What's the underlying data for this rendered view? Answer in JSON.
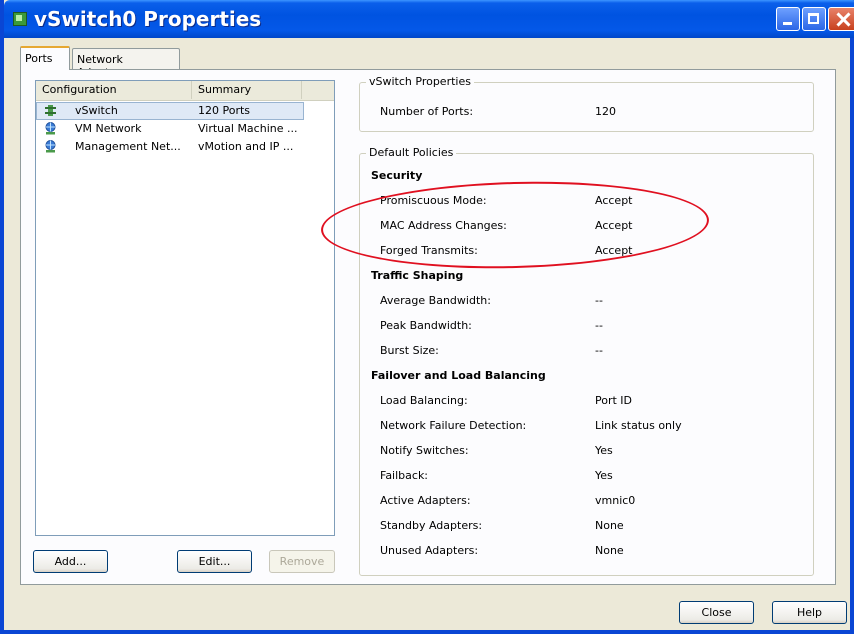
{
  "window": {
    "title": "vSwitch0 Properties"
  },
  "tabs": [
    {
      "label": "Ports"
    },
    {
      "label": "Network Adapters"
    }
  ],
  "list": {
    "headers": [
      "Configuration",
      "Summary"
    ],
    "rows": [
      {
        "icon": "vswitch-icon",
        "label": "vSwitch",
        "summary": "120 Ports"
      },
      {
        "icon": "network-globe-icon",
        "label": "VM Network",
        "summary": "Virtual Machine ..."
      },
      {
        "icon": "network-globe-icon",
        "label": "Management Net...",
        "summary": "vMotion and IP ..."
      }
    ]
  },
  "list_buttons": {
    "add": "Add...",
    "edit": "Edit...",
    "remove": "Remove"
  },
  "vswitch_properties": {
    "title": "vSwitch Properties",
    "number_of_ports_label": "Number of Ports:",
    "number_of_ports_value": "120"
  },
  "default_policies": {
    "title": "Default Policies",
    "security": {
      "heading": "Security",
      "items": [
        {
          "label": "Promiscuous Mode:",
          "value": "Accept"
        },
        {
          "label": "MAC Address Changes:",
          "value": "Accept"
        },
        {
          "label": "Forged Transmits:",
          "value": "Accept"
        }
      ]
    },
    "traffic_shaping": {
      "heading": "Traffic Shaping",
      "items": [
        {
          "label": "Average Bandwidth:",
          "value": "--"
        },
        {
          "label": "Peak Bandwidth:",
          "value": "--"
        },
        {
          "label": "Burst Size:",
          "value": "--"
        }
      ]
    },
    "failover": {
      "heading": "Failover and Load Balancing",
      "items": [
        {
          "label": "Load Balancing:",
          "value": "Port ID"
        },
        {
          "label": "Network Failure Detection:",
          "value": "Link status only"
        },
        {
          "label": "Notify Switches:",
          "value": "Yes"
        },
        {
          "label": "Failback:",
          "value": "Yes"
        },
        {
          "label": "Active Adapters:",
          "value": "vmnic0"
        },
        {
          "label": "Standby Adapters:",
          "value": "None"
        },
        {
          "label": "Unused Adapters:",
          "value": "None"
        }
      ]
    }
  },
  "footer": {
    "close": "Close",
    "help": "Help"
  },
  "colors": {
    "annotation": "#e01020",
    "titlebar": "#0053e1",
    "selection": "#dfe9f6"
  }
}
